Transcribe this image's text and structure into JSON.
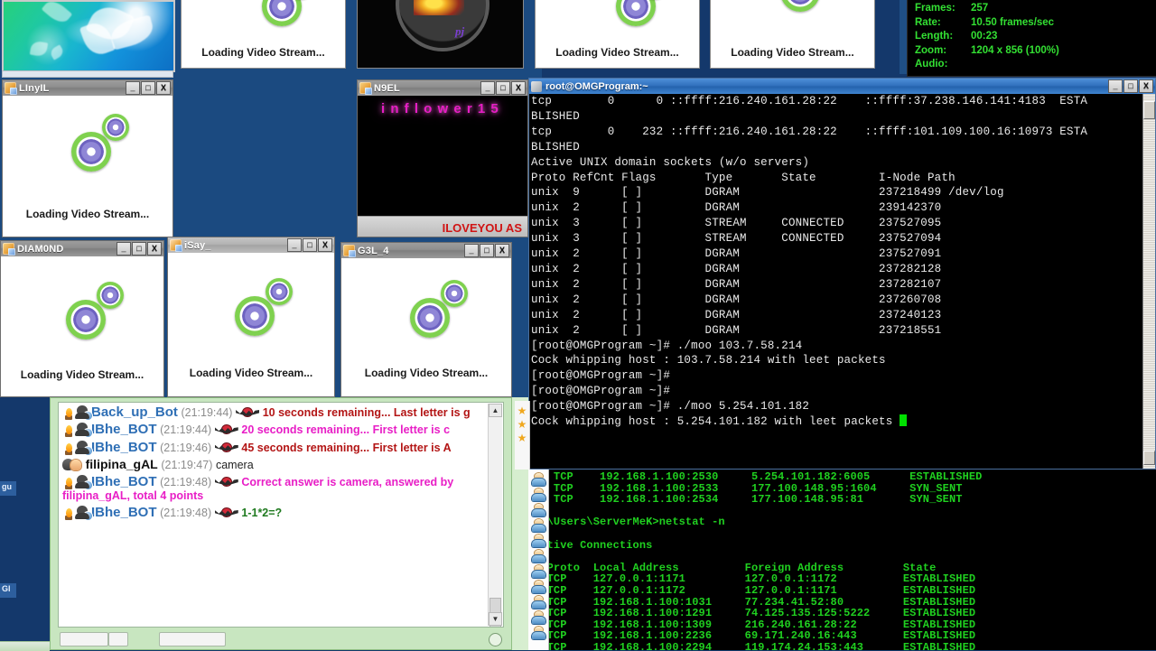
{
  "desktop": {
    "background_color": "#123a6b"
  },
  "video_windows": [
    {
      "caption": "Loading Video Stream...",
      "kind": "loading"
    },
    {
      "caption": "",
      "kind": "video_trish"
    },
    {
      "caption": "Loading Video Stream...",
      "kind": "loading"
    },
    {
      "caption": "Loading Video Stream...",
      "kind": "loading"
    }
  ],
  "camera_stats": {
    "rows": [
      {
        "key": "Frames:",
        "value": "257"
      },
      {
        "key": "Rate:",
        "value": "10.50 frames/sec"
      },
      {
        "key": "Length:",
        "value": "00:23"
      },
      {
        "key": "Zoom:",
        "value": "1204 x 856 (100%)"
      },
      {
        "key": "Audio:",
        "value": ""
      }
    ],
    "accent_color": "#33e033"
  },
  "cam_windows": [
    {
      "title": "LInyIL",
      "caption": "Loading Video Stream...",
      "kind": "loading"
    },
    {
      "title": "N9EL",
      "caption": "ILOVEYOU AS",
      "kind": "video_text",
      "overlay_text": "i n f l o w e r 1 5"
    },
    {
      "title": "DIAM0ND",
      "caption": "Loading Video Stream...",
      "kind": "loading"
    },
    {
      "title": "iSay_",
      "caption": "Loading Video Stream...",
      "kind": "loading"
    },
    {
      "title": "G3L_4",
      "caption": "Loading Video Stream...",
      "kind": "loading"
    }
  ],
  "window_buttons": {
    "minimize": "_",
    "maximize": "□",
    "close": "X"
  },
  "putty": {
    "title": "root@OMGProgram:~",
    "lines": [
      "tcp        0      0 ::ffff:216.240.161.28:22    ::ffff:37.238.146.141:4183  ESTA",
      "BLISHED",
      "tcp        0    232 ::ffff:216.240.161.28:22    ::ffff:101.109.100.16:10973 ESTA",
      "BLISHED",
      "Active UNIX domain sockets (w/o servers)",
      "Proto RefCnt Flags       Type       State         I-Node Path",
      "unix  9      [ ]         DGRAM                    237218499 /dev/log",
      "unix  2      [ ]         DGRAM                    239142370",
      "unix  3      [ ]         STREAM     CONNECTED     237527095",
      "unix  3      [ ]         STREAM     CONNECTED     237527094",
      "unix  2      [ ]         DGRAM                    237527091",
      "unix  2      [ ]         DGRAM                    237282128",
      "unix  2      [ ]         DGRAM                    237282107",
      "unix  2      [ ]         DGRAM                    237260708",
      "unix  2      [ ]         DGRAM                    237240123",
      "unix  2      [ ]         DGRAM                    237218551",
      "[root@OMGProgram ~]# ./moo 103.7.58.214",
      "",
      "Cock whipping host : 103.7.58.214 with leet packets",
      "[root@OMGProgram ~]#",
      "[root@OMGProgram ~]#",
      "[root@OMGProgram ~]# ./moo 5.254.101.182",
      "",
      "Cock whipping host : 5.254.101.182 with leet packets "
    ]
  },
  "cmd": {
    "lines": [
      "   TCP    192.168.1.100:2530     5.254.101.182:6005      ESTABLISHED",
      "   TCP    192.168.1.100:2533     177.100.148.95:1604     SYN_SENT",
      "   TCP    192.168.1.100:2534     177.100.148.95:81       SYN_SENT",
      "",
      "C:\\Users\\ServerMeK>netstat -n",
      "",
      "Active Connections",
      "",
      "  Proto  Local Address          Foreign Address         State",
      "  TCP    127.0.0.1:1171         127.0.0.1:1172          ESTABLISHED",
      "  TCP    127.0.0.1:1172         127.0.0.1:1171          ESTABLISHED",
      "  TCP    192.168.1.100:1031     77.234.41.52:80         ESTABLISHED",
      "  TCP    192.168.1.100:1291     74.125.135.125:5222     ESTABLISHED",
      "  TCP    192.168.1.100:1309     216.240.161.28:22       ESTABLISHED",
      "  TCP    192.168.1.100:2236     69.171.240.16:443       ESTABLISHED",
      "  TCP    192.168.1.100:2294     119.174.24.153:443      ESTABLISHED"
    ],
    "text_color": "#20d020"
  },
  "chat": {
    "messages": [
      {
        "nick": "Back_up_Bot",
        "nick_type": "bot",
        "time": "(21:19:44)",
        "body": "10 seconds remaining... Last letter is g",
        "body_color": "red",
        "icons": [
          "flame-icon",
          "ninja-avatar-icon",
          "bat-icon"
        ]
      },
      {
        "nick": "IBhe_BOT",
        "nick_type": "bot",
        "time": "(21:19:44)",
        "body": "20 seconds remaining... First letter is c",
        "body_color": "pink",
        "icons": [
          "flame-icon",
          "ninja-avatar-icon",
          "bat-icon"
        ]
      },
      {
        "nick": "IBhe_BOT",
        "nick_type": "bot",
        "time": "(21:19:46)",
        "body": "45 seconds remaining... First letter is A",
        "body_color": "red",
        "icons": [
          "flame-icon",
          "ninja-avatar-icon",
          "bat-icon"
        ]
      },
      {
        "nick": "filipina_gAL",
        "nick_type": "user",
        "time": "(21:19:47)",
        "body": "camera",
        "body_color": "plain",
        "icons": [
          "couple-avatar-icon"
        ]
      },
      {
        "nick": "IBhe_BOT",
        "nick_type": "bot",
        "time": "(21:19:48)",
        "body": "Correct answer is camera, answered by filipina_gAL, total 4 points",
        "body_color": "pink",
        "icons": [
          "flame-icon",
          "ninja-avatar-icon",
          "bat-icon"
        ]
      },
      {
        "nick": "IBhe_BOT",
        "nick_type": "bot",
        "time": "(21:19:48)",
        "body": "1-1*2=?",
        "body_color": "green",
        "icons": [
          "flame-icon",
          "ninja-avatar-icon",
          "bat-icon"
        ]
      }
    ],
    "scroll_up_arrow": "▲",
    "scroll_down_arrow": "▼"
  },
  "side_tabs": [
    {
      "label": "gu"
    },
    {
      "label": "Gl"
    }
  ]
}
